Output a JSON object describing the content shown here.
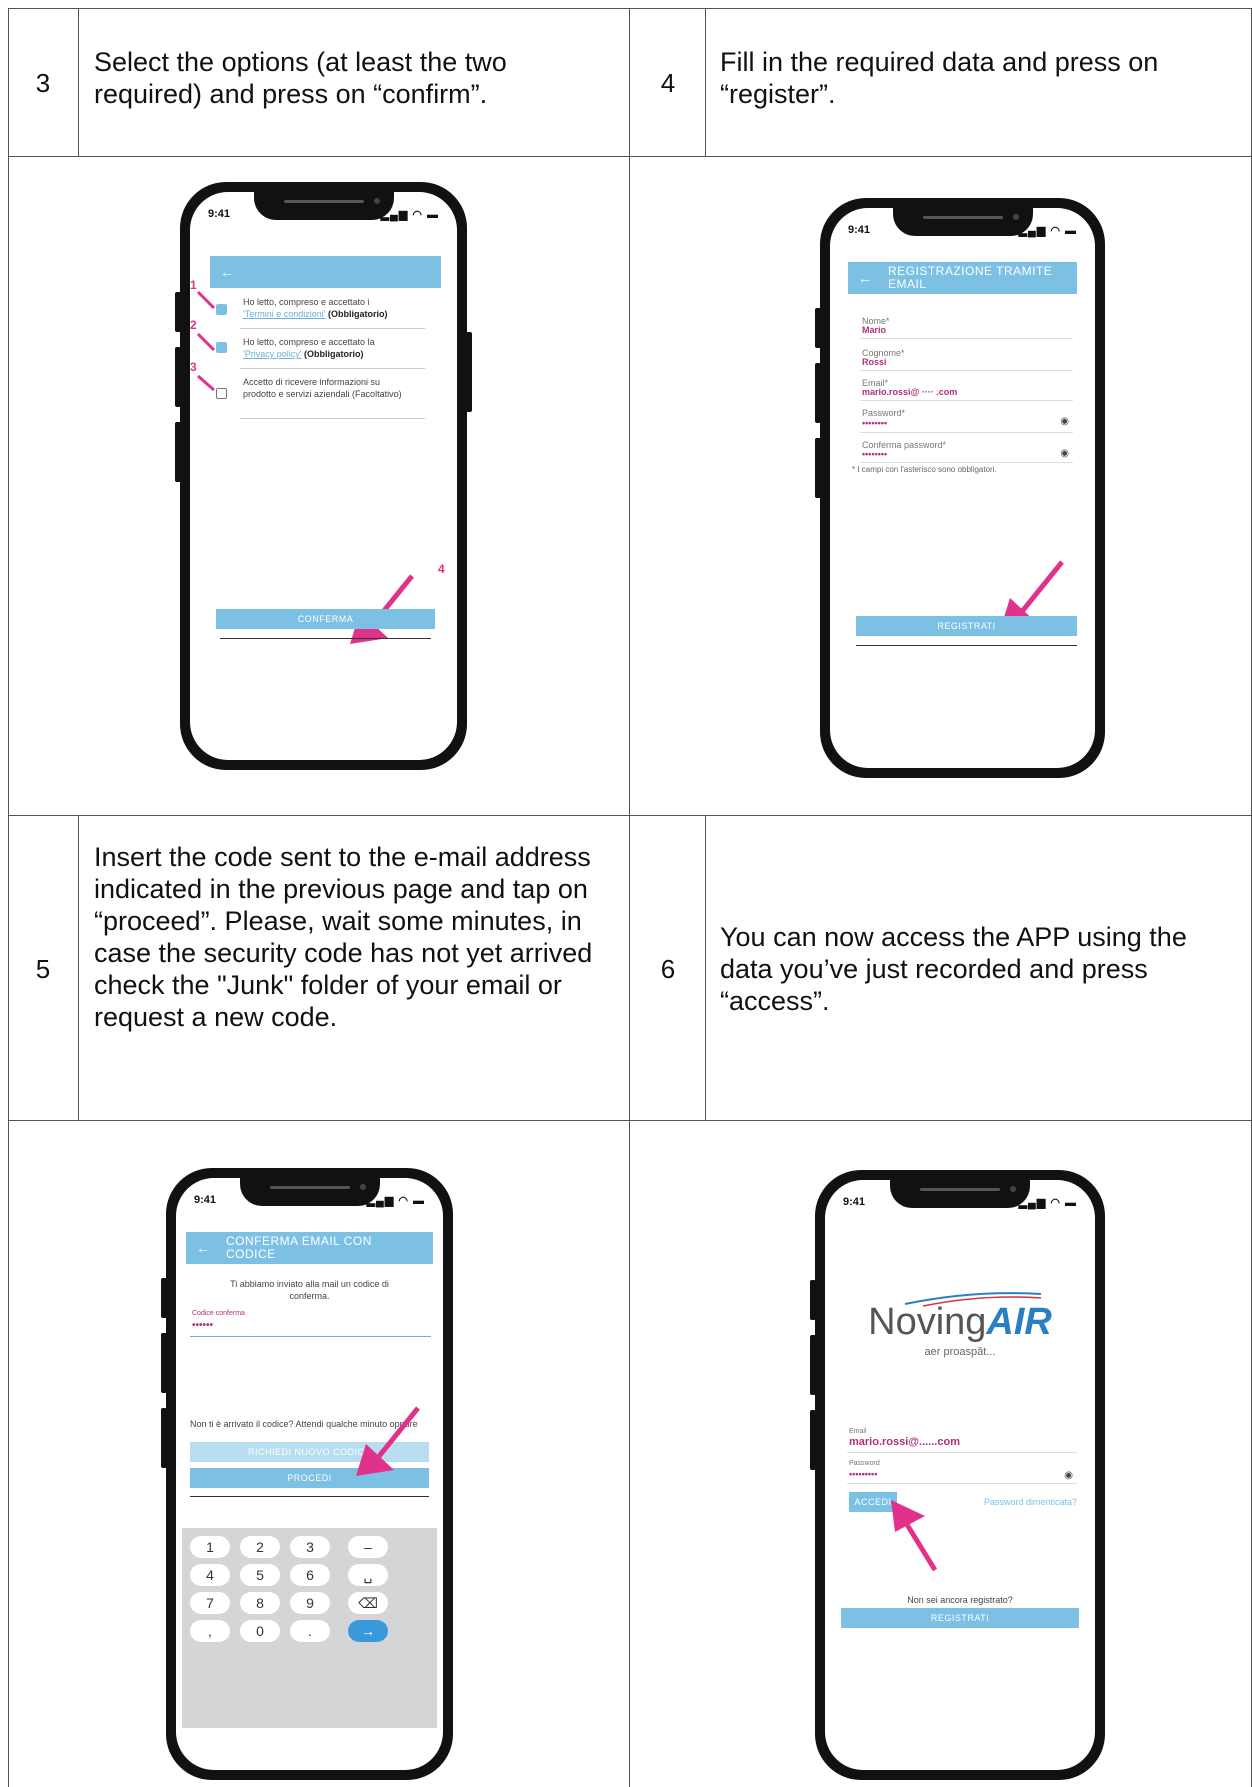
{
  "steps": [
    {
      "num": "3",
      "text": "Select the options (at least the two required) and press on “confirm”."
    },
    {
      "num": "4",
      "text": "Fill in the required data and press on “register”."
    },
    {
      "num": "5",
      "text": "Insert the code sent to the e-mail address indicated in the previous page and tap on “proceed”. Please, wait some minutes, in case the security code has not yet arrived check the \"Junk\" folder of your email or request a new code."
    },
    {
      "num": "6",
      "text": "You can now access the APP using the data you’ve just recorded and press “access”."
    }
  ],
  "status": {
    "time": "9:41",
    "icons": "▂▄▆ ◠ ▬"
  },
  "screen3": {
    "back": "←",
    "marks": [
      "1",
      "2",
      "3",
      "4"
    ],
    "opt1_a": "Ho letto, compreso e accettato i",
    "opt1_link": "'Termini e condizioni'",
    "opt1_b": "(Obbligatorio)",
    "opt2_a": "Ho letto, compreso e accettato la",
    "opt2_link": "'Privacy policy'",
    "opt2_b": "(Obbligatorio)",
    "opt3": "Accetto di ricevere informazioni su prodotto e servizi aziendali (Facoltativo)",
    "button": "CONFERMA"
  },
  "screen4": {
    "back": "←",
    "title": "REGISTRAZIONE TRAMITE EMAIL",
    "fields": [
      {
        "label": "Nome*",
        "value": "Mario"
      },
      {
        "label": "Cognome*",
        "value": "Rossi"
      },
      {
        "label": "Email*",
        "value": "mario.rossi@ ···· .com"
      },
      {
        "label": "Password*",
        "value": "••••••••"
      },
      {
        "label": "Conferma password*",
        "value": "••••••••"
      }
    ],
    "note": "* I campi con l'asterisco sono obbligatori.",
    "button": "REGISTRATI"
  },
  "screen5": {
    "back": "←",
    "title": "CONFERMA EMAIL CON CODICE",
    "intro": "Ti abbiamo inviato alla mail un codice di conferma.",
    "code_label": "Codice conferma",
    "code_value": "••••••",
    "no_code": "Non ti è arrivato il codice? Attendi qualche minuto oppure",
    "resend": "RICHIEDI NUOVO CODICE",
    "proceed": "PROCEDI",
    "keys": [
      "1",
      "2",
      "3",
      "–",
      "4",
      "5",
      "6",
      "␣",
      "7",
      "8",
      "9",
      "⌫",
      ",",
      "0",
      ".",
      "→"
    ]
  },
  "screen6": {
    "logo_a": "Noving",
    "logo_b": "AIR",
    "tagline": "aer proaspăt...",
    "email_label": "Email",
    "email_value": "mario.rossi@......com",
    "pw_label": "Password",
    "pw_value": "•••••••••",
    "login": "ACCEDI",
    "forgot": "Password dimenticata?",
    "not_registered": "Non sei ancora registrato?",
    "register": "REGISTRATI"
  },
  "colors": {
    "accent": "#7cc0e4",
    "marker": "#e0328a",
    "value": "#b0307a"
  }
}
